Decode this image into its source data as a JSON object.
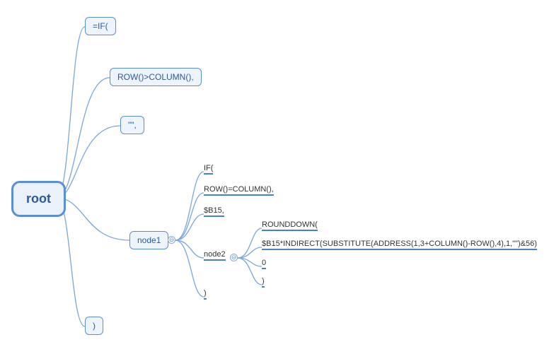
{
  "root": {
    "label": "root"
  },
  "level1": {
    "n0": "=IF(",
    "n1": "ROW()>COLUMN(),",
    "n2": "\"\",",
    "n3": "node1",
    "n4": ")"
  },
  "node1_children": {
    "c0": "IF(",
    "c1": "ROW()=COLUMN(),",
    "c2": "$B15,",
    "c3": "node2",
    "c4": ")"
  },
  "node2_children": {
    "d0": "ROUNDDOWN(",
    "d1": "$B15*INDIRECT(SUBSTITUTE(ADDRESS(1,3+COLUMN()-ROW(),4),1,\"\")&56)",
    "d2": "0",
    "d3": ")"
  },
  "toggles": {
    "node1": "⊖",
    "node2": "⊖"
  }
}
